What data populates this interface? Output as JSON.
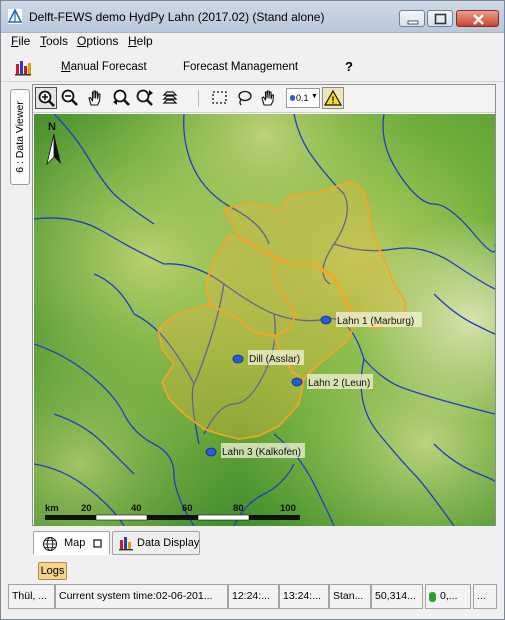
{
  "window": {
    "title": "Delft-FEWS demo HydPy Lahn (2017.02)  (Stand alone)"
  },
  "menu": [
    {
      "label": "File",
      "mnemonic": "F",
      "rest": "ile"
    },
    {
      "label": "Tools",
      "mnemonic": "T",
      "rest": "ools"
    },
    {
      "label": "Options",
      "mnemonic": "O",
      "rest": "ptions"
    },
    {
      "label": "Help",
      "mnemonic": "H",
      "rest": "elp"
    }
  ],
  "toolbar": {
    "manual_forecast": "Manual Forecast",
    "manual_forecast_mnemonic": "M",
    "manual_forecast_rest": "anual Forecast",
    "forecast_management": "Forecast Management",
    "help": "?"
  },
  "side_tab": {
    "label": "6 : Data Viewer"
  },
  "map_toolbar": {
    "tools": [
      "zoom-in-icon",
      "zoom-out-icon",
      "pan-hand-icon",
      "zoom-back-icon",
      "zoom-forward-icon",
      "layers-icon",
      "rectangle-select-icon",
      "lasso-select-icon",
      "select-hand-icon"
    ],
    "select_value": "0.1",
    "warning": "!"
  },
  "map": {
    "north_label": "N",
    "stations": [
      {
        "name": "Lahn 1 (Marburg)"
      },
      {
        "name": "Dill (Asslar)"
      },
      {
        "name": "Lahn 2 (Leun)"
      },
      {
        "name": "Lahn 3 (Kalkofen)"
      }
    ],
    "scale": {
      "unit": "km",
      "ticks": [
        "20",
        "40",
        "60",
        "80",
        "100"
      ]
    },
    "colors": {
      "catchment": "#f5a623",
      "river": "#1f3fbf",
      "station": "#2a5bd7"
    }
  },
  "bottom_tabs": [
    {
      "label": "Map",
      "selected": true
    },
    {
      "label": "Data Display",
      "selected": false
    }
  ],
  "logs": {
    "label": "Logs"
  },
  "status": {
    "user": "Thül, ...",
    "system_time": "Current system time:02-06-201...",
    "time_a": "12:24:...",
    "time_b": "13:24:...",
    "mode": "Stan...",
    "coords": "50,314...",
    "indicator": "0,...",
    "extra": "..."
  }
}
